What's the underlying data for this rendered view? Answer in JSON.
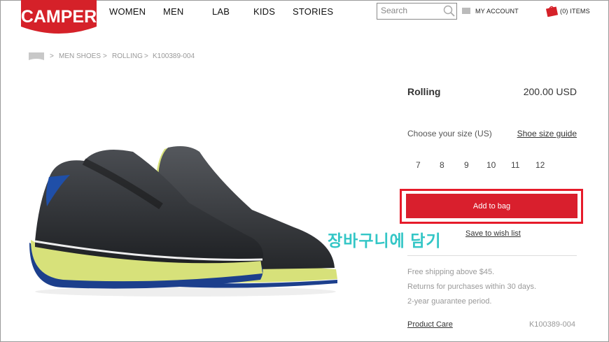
{
  "brand": {
    "logo_text": "CAMPER",
    "color": "#d52129"
  },
  "nav": [
    "WOMEN",
    "MEN",
    "LAB",
    "KIDS",
    "STORIES"
  ],
  "search": {
    "placeholder": "Search",
    "icon": "search-icon"
  },
  "account": {
    "label": "MY ACCOUNT",
    "icon": "user-icon"
  },
  "bag": {
    "label": "(0) ITEMS",
    "icon": "bag-icon"
  },
  "breadcrumb": {
    "home_icon": "home-icon",
    "items": [
      "MEN SHOES",
      "ROLLING",
      "K100389-004"
    ]
  },
  "product": {
    "name": "Rolling",
    "price": "200.00  USD",
    "size_label": "Choose your size (US)",
    "size_guide": "Shoe size guide",
    "sizes": [
      "7",
      "8",
      "9",
      "10",
      "11",
      "12"
    ],
    "add_to_bag": "Add to bag",
    "wish_list": "Save to wish list",
    "info": [
      "Free shipping above $45.",
      "Returns for purchases within 30 days.",
      "2-year guarantee period."
    ],
    "care": "Product Care",
    "ref": "K100389-004"
  },
  "annotation": {
    "text": "장바구니에 담기",
    "color": "#33c6c6",
    "highlight_color": "#e61b2a"
  }
}
